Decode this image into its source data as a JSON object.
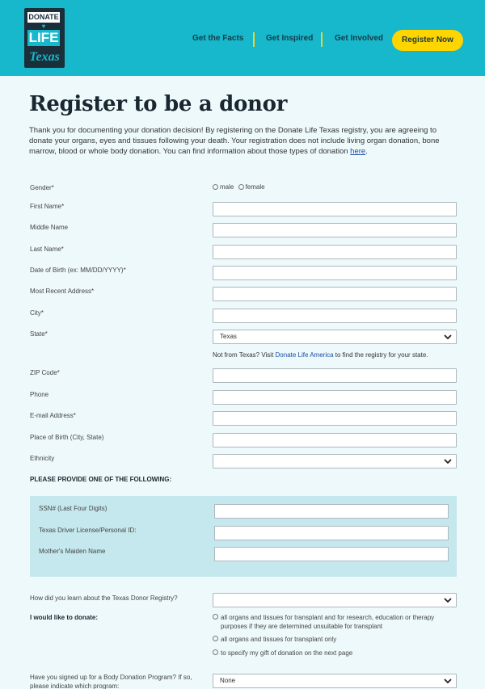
{
  "header": {
    "logo": {
      "line1": "DONATE",
      "line2": "LIFE",
      "line3": "Texas"
    },
    "nav": [
      "Get the Facts",
      "Get Inspired",
      "Get Involved"
    ],
    "register_label": "Register Now"
  },
  "title": "Register to be a donor",
  "intro": {
    "text": "Thank you for documenting your donation decision! By registering on the Donate Life Texas registry, you are agreeing to donate your organs, eyes and tissues following your death. Your registration does not include living organ donation, bone marrow, blood or whole body donation. You can find information about those types of donation ",
    "link": "here",
    "end": "."
  },
  "form": {
    "gender_label": "Gender*",
    "gender_options": [
      "male",
      "female"
    ],
    "first_name_label": "First Name*",
    "middle_name_label": "Middle Name",
    "last_name_label": "Last Name*",
    "dob_label": "Date of Birth (ex: MM/DD/YYYY)*",
    "address_label": "Most Recent Address*",
    "city_label": "City*",
    "state_label": "State*",
    "state_value": "Texas",
    "state_note_prefix": "Not from Texas? Visit ",
    "state_note_link": "Donate Life America",
    "state_note_suffix": " to find the registry for your state.",
    "zip_label": "ZIP Code*",
    "phone_label": "Phone",
    "email_label": "E-mail Address*",
    "birthplace_label": "Place of Birth (City, State)",
    "ethnicity_label": "Ethnicity",
    "ethnicity_value": "",
    "section_head": "PLEASE PROVIDE ONE OF THE FOLLOWING:",
    "ssn_label": "SSN# (Last Four Digits)",
    "license_label": "Texas Driver License/Personal ID:",
    "maiden_label": "Mother's Maiden Name",
    "learn_label": "How did you learn about the Texas Donor Registry?",
    "learn_value": "",
    "donate_label": "I would like to donate:",
    "donate_options": [
      "all organs and tissues for transplant and for research, education or therapy purposes if they are determined unsuitable for transplant",
      "all organs and tissues for transplant only",
      "to specify my gift of donation on the next page"
    ],
    "body_program_label": "Have you signed up for a Body Donation Program? If so, please indicate which program:",
    "body_program_value": "None"
  },
  "colors": {
    "header": "#17b7cc",
    "accent": "#ffd500",
    "panel": "#c5e8ee",
    "background": "#eef9fb"
  }
}
